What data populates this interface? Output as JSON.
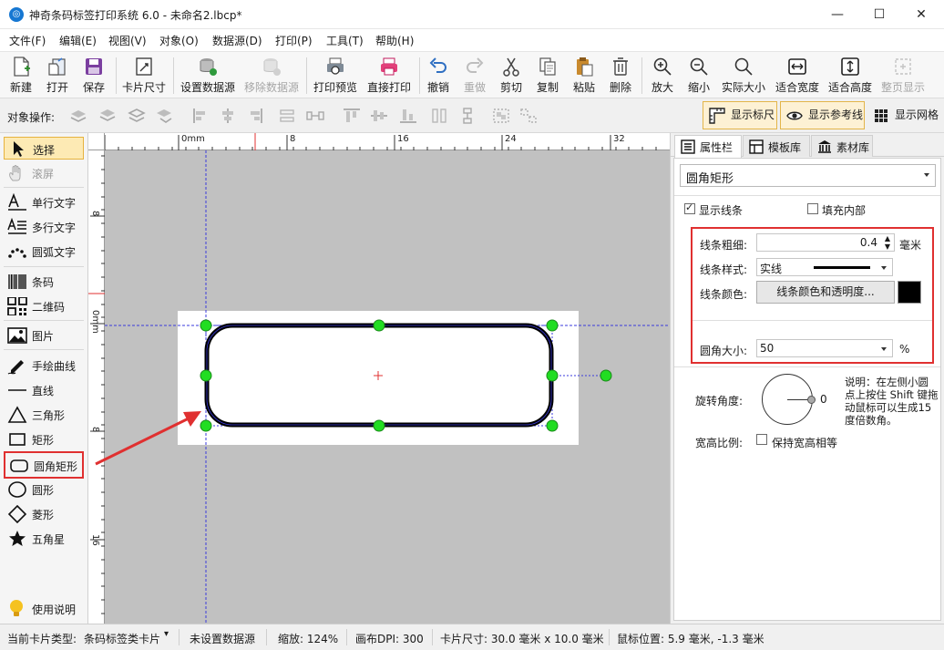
{
  "window": {
    "title": "神奇条码标签打印系统 6.0 - 未命名2.lbcp*",
    "app_icon_glyph": "◎",
    "minimize": "—",
    "maximize": "☐",
    "close": "✕"
  },
  "menu": [
    "文件(F)",
    "编辑(E)",
    "视图(V)",
    "对象(O)",
    "数据源(D)",
    "打印(P)",
    "工具(T)",
    "帮助(H)"
  ],
  "toolbar": [
    {
      "label": "新建",
      "icon": "new-file-icon"
    },
    {
      "label": "打开",
      "icon": "open-icon"
    },
    {
      "label": "保存",
      "icon": "save-icon"
    },
    {
      "label": "卡片尺寸",
      "icon": "card-size-icon"
    },
    {
      "label": "设置数据源",
      "icon": "database-icon"
    },
    {
      "label": "移除数据源",
      "icon": "remove-database-icon",
      "disabled": true
    },
    {
      "label": "打印预览",
      "icon": "print-preview-icon"
    },
    {
      "label": "直接打印",
      "icon": "printer-icon"
    },
    {
      "label": "撤销",
      "icon": "undo-icon"
    },
    {
      "label": "重做",
      "icon": "redo-icon",
      "disabled": true
    },
    {
      "label": "剪切",
      "icon": "scissors-icon"
    },
    {
      "label": "复制",
      "icon": "copy-icon"
    },
    {
      "label": "粘贴",
      "icon": "paste-icon"
    },
    {
      "label": "删除",
      "icon": "trash-icon"
    },
    {
      "label": "放大",
      "icon": "zoom-in-icon"
    },
    {
      "label": "缩小",
      "icon": "zoom-out-icon"
    },
    {
      "label": "实际大小",
      "icon": "zoom-actual-icon"
    },
    {
      "label": "适合宽度",
      "icon": "fit-width-icon"
    },
    {
      "label": "适合高度",
      "icon": "fit-height-icon"
    },
    {
      "label": "整页显示",
      "icon": "fit-page-icon",
      "disabled": true
    }
  ],
  "ops": {
    "label": "对象操作:",
    "toggles": [
      {
        "label": "显示标尺",
        "on": true,
        "icon": "ruler-icon"
      },
      {
        "label": "显示参考线",
        "on": true,
        "icon": "eye-icon"
      },
      {
        "label": "显示网格",
        "on": false,
        "icon": "grid-icon"
      }
    ]
  },
  "tools": [
    {
      "label": "选择",
      "icon": "arrow-cursor-icon",
      "selected": true
    },
    {
      "label": "滚屏",
      "icon": "hand-icon",
      "disabled": true
    },
    {
      "label": "单行文字",
      "icon": "single-line-text-icon"
    },
    {
      "label": "多行文字",
      "icon": "multi-line-text-icon"
    },
    {
      "label": "圆弧文字",
      "icon": "arc-text-icon"
    },
    {
      "label": "条码",
      "icon": "barcode-icon"
    },
    {
      "label": "二维码",
      "icon": "qrcode-icon"
    },
    {
      "label": "图片",
      "icon": "image-icon"
    },
    {
      "label": "手绘曲线",
      "icon": "pencil-icon"
    },
    {
      "label": "直线",
      "icon": "line-icon"
    },
    {
      "label": "三角形",
      "icon": "triangle-icon"
    },
    {
      "label": "矩形",
      "icon": "rectangle-icon"
    },
    {
      "label": "圆角矩形",
      "icon": "rounded-rectangle-icon",
      "highlighted": true
    },
    {
      "label": "圆形",
      "icon": "circle-icon"
    },
    {
      "label": "菱形",
      "icon": "diamond-icon"
    },
    {
      "label": "五角星",
      "icon": "star-icon"
    },
    {
      "label": "使用说明",
      "icon": "lightbulb-icon"
    }
  ],
  "rulers": {
    "top": [
      "0mm",
      "8",
      "16",
      "24",
      "32"
    ],
    "left": [
      "8",
      "0mm",
      "8",
      "16"
    ]
  },
  "right_panel": {
    "tabs": [
      {
        "label": "属性栏",
        "icon": "list-icon",
        "active": true
      },
      {
        "label": "模板库",
        "icon": "template-icon"
      },
      {
        "label": "素材库",
        "icon": "library-icon"
      }
    ],
    "shape_type": "圆角矩形",
    "show_border_label": "显示线条",
    "show_border_checked": true,
    "fill_label": "填充内部",
    "fill_checked": false,
    "line_width_label": "线条粗细:",
    "line_width_value": "0.4",
    "line_width_unit": "毫米",
    "line_style_label": "线条样式:",
    "line_style_value": "实线",
    "line_color_label": "线条颜色:",
    "line_color_button": "线条颜色和透明度...",
    "line_color": "#000000",
    "corner_label": "圆角大小:",
    "corner_value": "50",
    "corner_unit": "%",
    "rotation_label": "旋转角度:",
    "rotation_value": "0",
    "rotation_hint": "说明：在左侧小圆点上按住 Shift 键拖动鼠标可以生成15度倍数角。",
    "aspect_label": "宽高比例:",
    "aspect_checkbox_label": "保持宽高相等",
    "aspect_checked": false
  },
  "status": {
    "card_type": "当前卡片类型:",
    "card_type_value": "条码标签类卡片",
    "datasource": "未设置数据源",
    "zoom": "缩放: 124%",
    "dpi": "画布DPI: 300",
    "card_size": "卡片尺寸: 30.0 毫米 x 10.0 毫米",
    "mouse_pos": "鼠标位置: 5.9 毫米, -1.3 毫米"
  },
  "colors": {
    "accent_red": "#e03030",
    "handle_green": "#22dd22",
    "guide_blue": "#3a3adc",
    "shape_stroke": "#000000"
  }
}
